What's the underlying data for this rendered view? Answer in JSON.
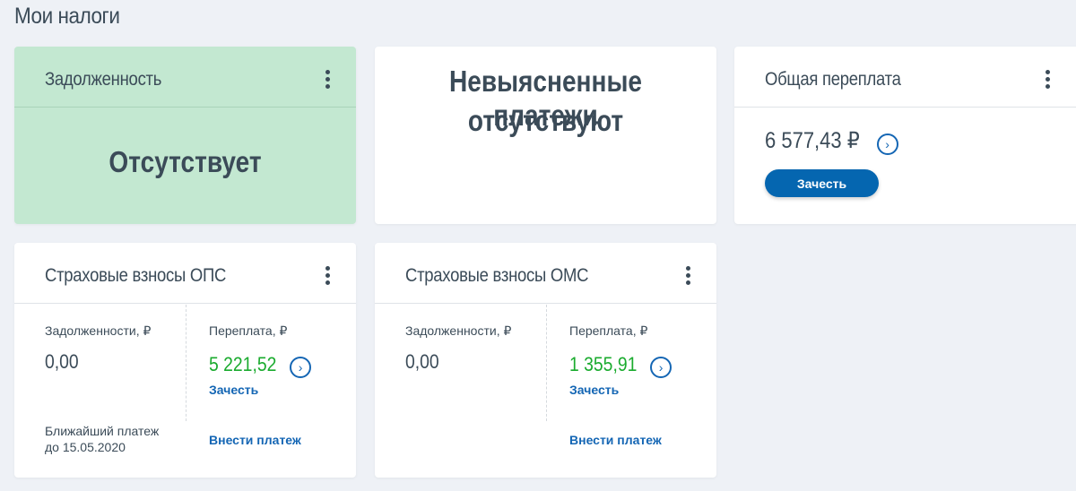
{
  "page_title": "Мои налоги",
  "debt_card": {
    "title": "Задолженность",
    "status": "Отсутствует"
  },
  "unclear_card": {
    "line1": "Невыясненные платежи",
    "line2": "отсутствуют"
  },
  "overpay_card": {
    "title": "Общая переплата",
    "amount": "6 577,43 ₽",
    "button": "Зачесть"
  },
  "ops_card": {
    "title": "Страховые взносы ОПС",
    "debt_label": "Задолженности, ₽",
    "debt_value": "0,00",
    "over_label": "Переплата, ₽",
    "over_value": "5 221,52",
    "offset_link": "Зачесть",
    "next_line1": "Ближайший платеж",
    "next_line2": "до 15.05.2020",
    "pay_link": "Внести платеж"
  },
  "oms_card": {
    "title": "Страховые взносы ОМС",
    "debt_label": "Задолженности, ₽",
    "debt_value": "0,00",
    "over_label": "Переплата, ₽",
    "over_value": "1 355,91",
    "offset_link": "Зачесть",
    "pay_link": "Внести платеж"
  },
  "colors": {
    "green_card": "#c3e8d1",
    "accent": "#0566b0",
    "positive": "#1aab2e"
  }
}
